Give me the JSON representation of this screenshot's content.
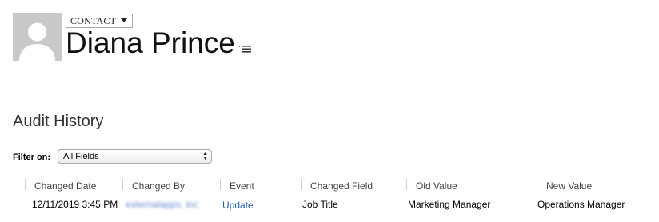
{
  "header": {
    "entity_type": "CONTACT",
    "record_name": "Diana Prince"
  },
  "audit": {
    "section_title": "Audit History",
    "filter_label": "Filter on:",
    "filter_value": "All Fields",
    "columns": [
      "Changed Date",
      "Changed By",
      "Event",
      "Changed Field",
      "Old Value",
      "New Value"
    ],
    "rows": [
      {
        "changed_date": "12/11/2019 3:45 PM",
        "changed_by": "externalapps, inc",
        "event": "Update",
        "changed_field": "Job Title",
        "old_value": "Marketing Manager",
        "new_value": "Operations Manager"
      }
    ]
  },
  "icons": {
    "avatar": "person-silhouette-icon",
    "entity_dropdown": "chevron-down-icon",
    "record_menu": "hamburger-menu-icon",
    "filter_select": "select-arrows-icon"
  },
  "colors": {
    "link": "#1f5fa8",
    "avatar_bg": "#c9c9c9"
  }
}
